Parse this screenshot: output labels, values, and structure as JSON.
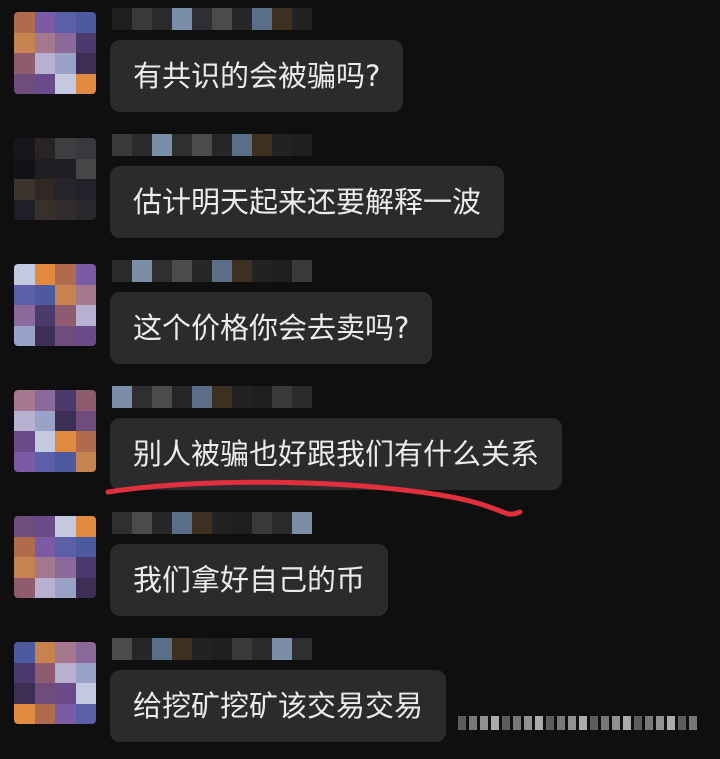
{
  "chat": {
    "messages": [
      {
        "text": "有共识的会被骗吗?"
      },
      {
        "text": "估计明天起来还要解释一波"
      },
      {
        "text": "这个价格你会去卖吗?"
      },
      {
        "text": "别人被骗也好跟我们有什么关系"
      },
      {
        "text": "我们拿好自己的币"
      },
      {
        "text": "给挖矿挖矿该交易交易"
      }
    ]
  },
  "colors": {
    "background": "#0f0f10",
    "bubble": "#2b2b2d",
    "text": "#ebebeb",
    "highlight_underline": "#e0303c"
  }
}
